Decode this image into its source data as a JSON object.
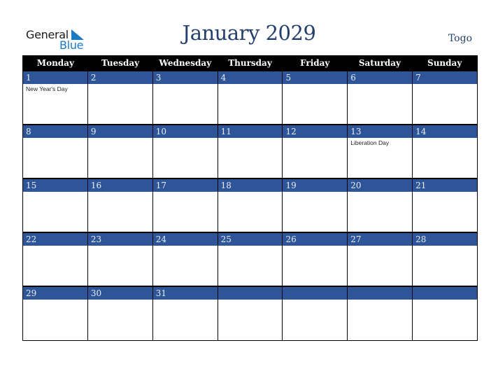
{
  "logo": {
    "line1": "General",
    "line2": "Blue"
  },
  "title": "January 2029",
  "country": "Togo",
  "weekdays": [
    "Monday",
    "Tuesday",
    "Wednesday",
    "Thursday",
    "Friday",
    "Saturday",
    "Sunday"
  ],
  "weeks": [
    [
      {
        "day": "1",
        "event": "New Year's Day"
      },
      {
        "day": "2",
        "event": ""
      },
      {
        "day": "3",
        "event": ""
      },
      {
        "day": "4",
        "event": ""
      },
      {
        "day": "5",
        "event": ""
      },
      {
        "day": "6",
        "event": ""
      },
      {
        "day": "7",
        "event": ""
      }
    ],
    [
      {
        "day": "8",
        "event": ""
      },
      {
        "day": "9",
        "event": ""
      },
      {
        "day": "10",
        "event": ""
      },
      {
        "day": "11",
        "event": ""
      },
      {
        "day": "12",
        "event": ""
      },
      {
        "day": "13",
        "event": "Liberation Day"
      },
      {
        "day": "14",
        "event": ""
      }
    ],
    [
      {
        "day": "15",
        "event": ""
      },
      {
        "day": "16",
        "event": ""
      },
      {
        "day": "17",
        "event": ""
      },
      {
        "day": "18",
        "event": ""
      },
      {
        "day": "19",
        "event": ""
      },
      {
        "day": "20",
        "event": ""
      },
      {
        "day": "21",
        "event": ""
      }
    ],
    [
      {
        "day": "22",
        "event": ""
      },
      {
        "day": "23",
        "event": ""
      },
      {
        "day": "24",
        "event": ""
      },
      {
        "day": "25",
        "event": ""
      },
      {
        "day": "26",
        "event": ""
      },
      {
        "day": "27",
        "event": ""
      },
      {
        "day": "28",
        "event": ""
      }
    ],
    [
      {
        "day": "29",
        "event": ""
      },
      {
        "day": "30",
        "event": ""
      },
      {
        "day": "31",
        "event": ""
      },
      {
        "day": "",
        "event": ""
      },
      {
        "day": "",
        "event": ""
      },
      {
        "day": "",
        "event": ""
      },
      {
        "day": "",
        "event": ""
      }
    ]
  ],
  "colors": {
    "header_bg": "#000000",
    "date_bar": "#2e5597",
    "title": "#233f6b",
    "logo_blue": "#1b7ac4"
  }
}
